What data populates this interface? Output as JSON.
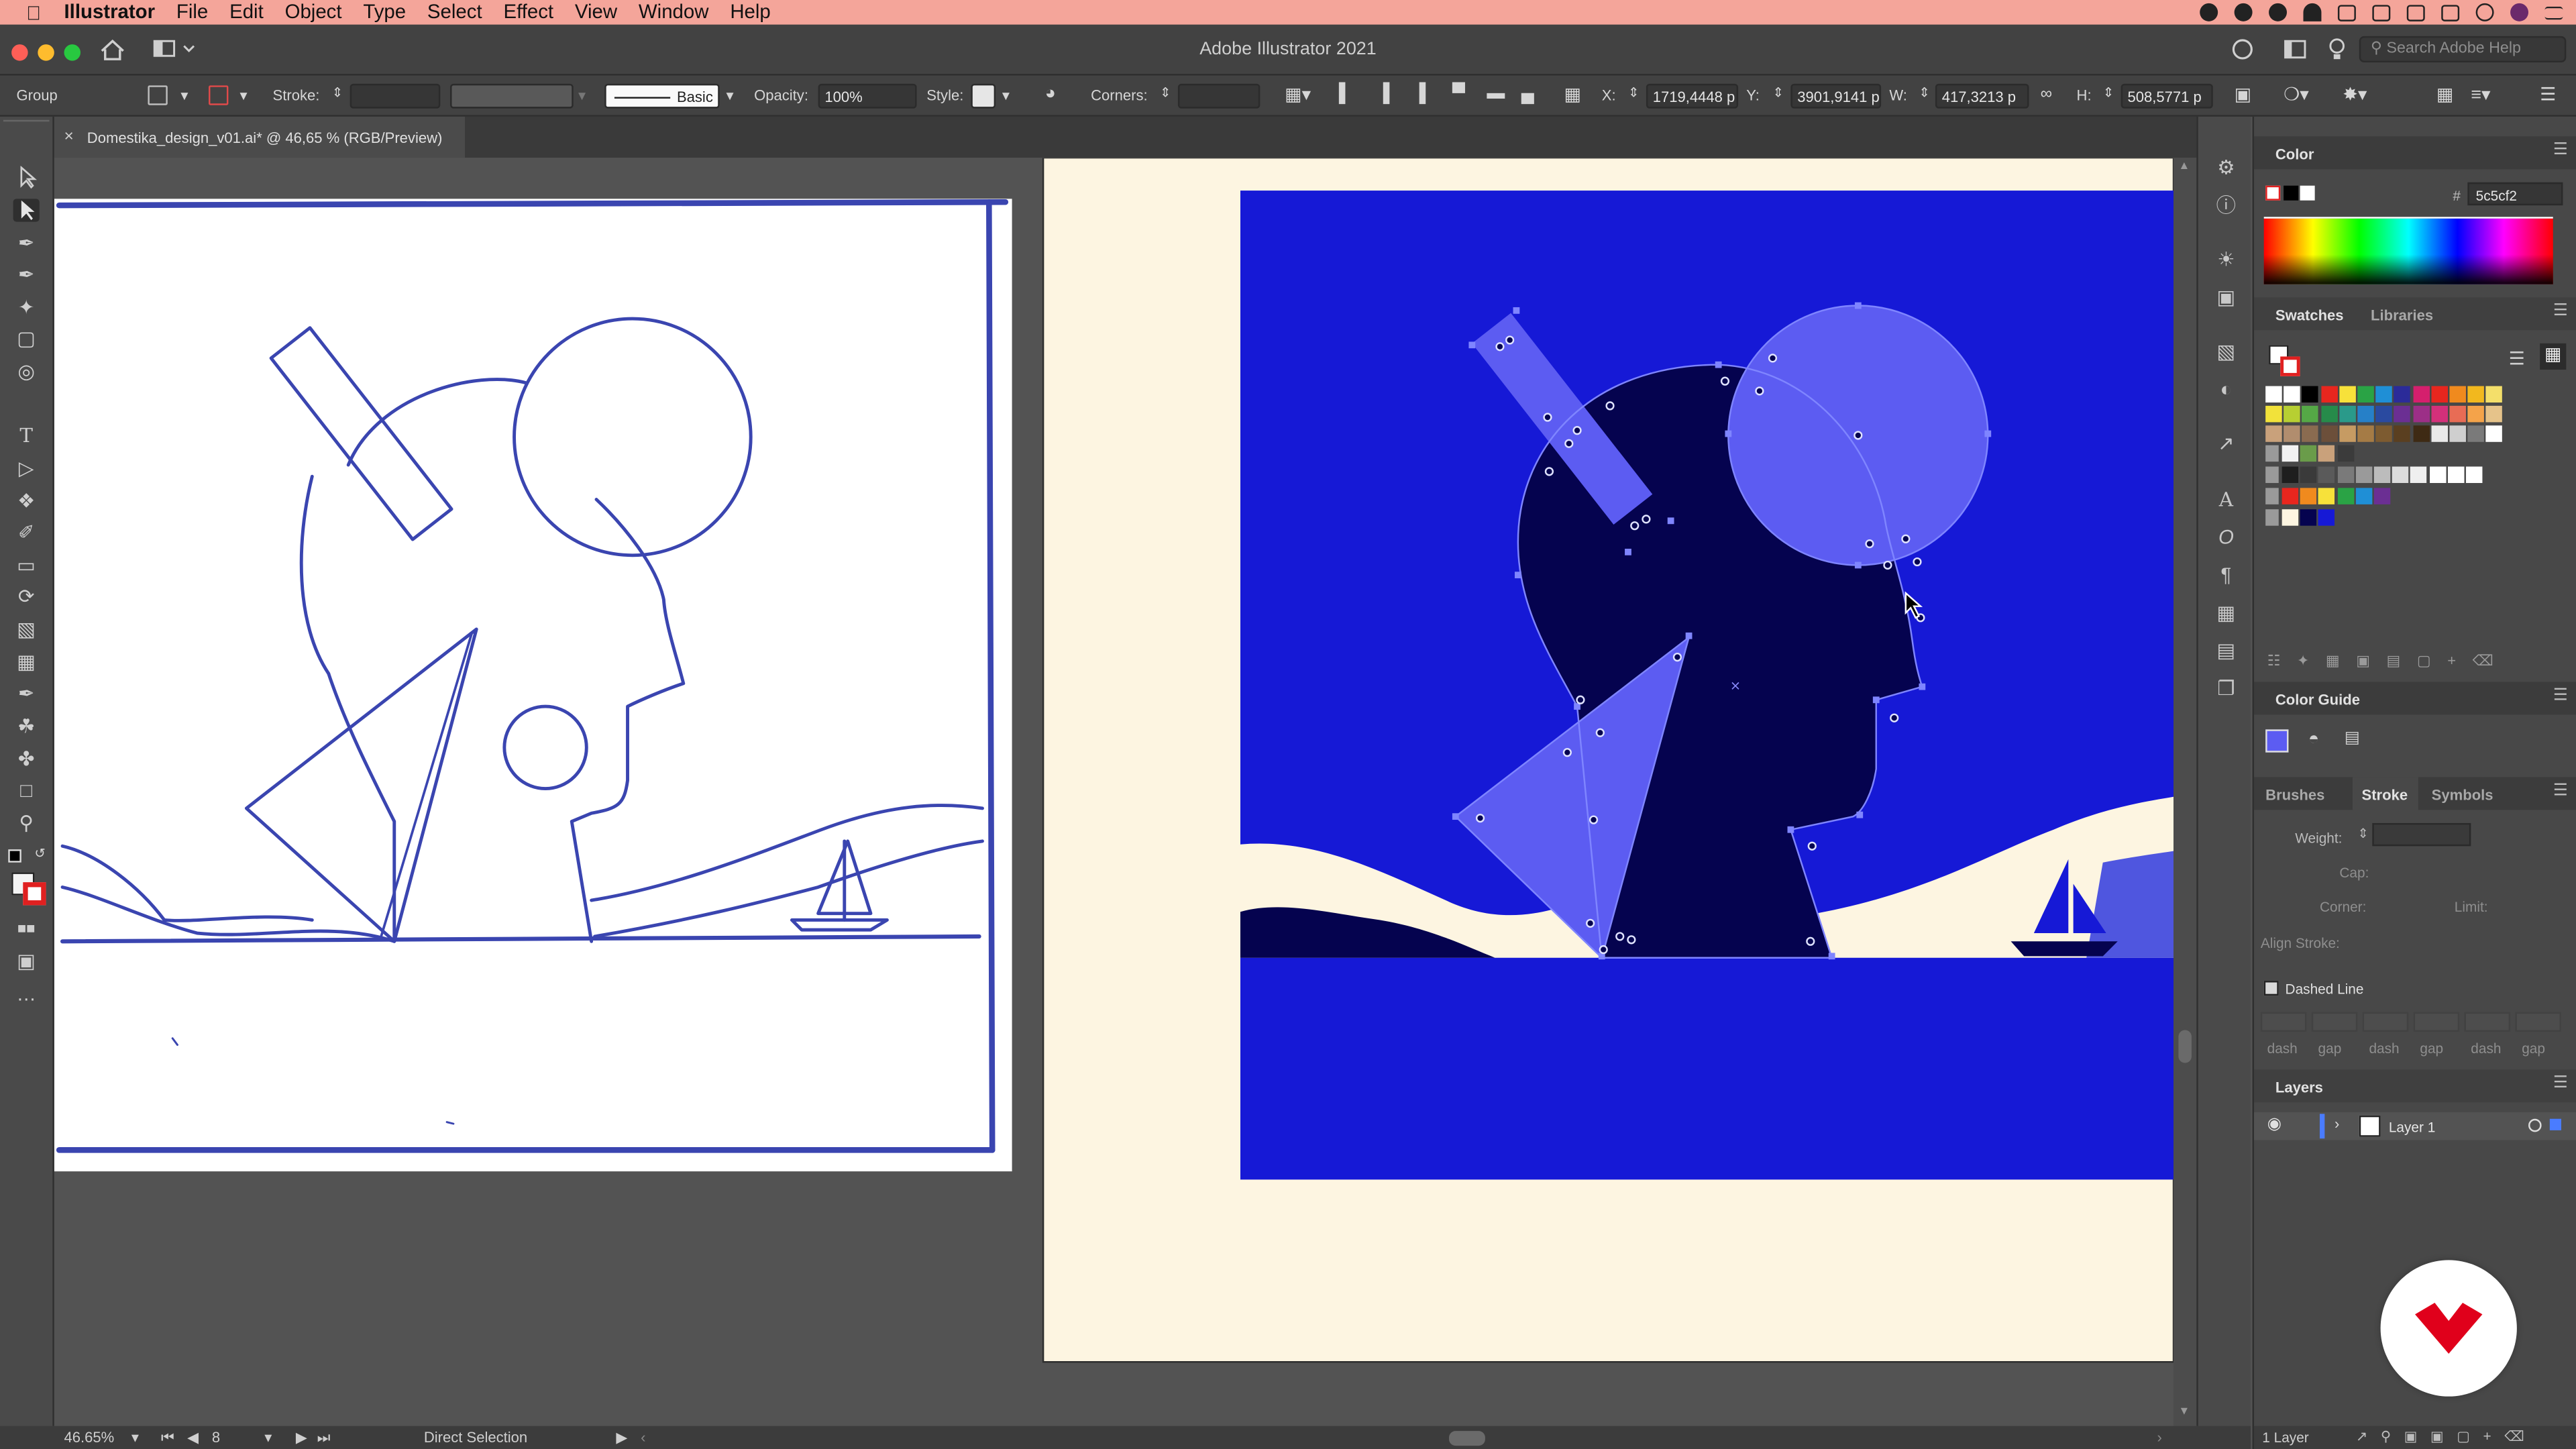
{
  "menubar": {
    "app_name": "Illustrator",
    "items": [
      "File",
      "Edit",
      "Object",
      "Type",
      "Select",
      "Effect",
      "View",
      "Window",
      "Help"
    ]
  },
  "window": {
    "title": "Adobe Illustrator 2021",
    "search_placeholder": "Search Adobe Help"
  },
  "control_bar": {
    "selection_type": "Group",
    "stroke_label": "Stroke:",
    "brush_style": "Basic",
    "opacity_label": "Opacity:",
    "opacity_value": "100%",
    "style_label": "Style:",
    "corners_label": "Corners:",
    "x_label": "X:",
    "x_value": "1719,4448 p",
    "y_label": "Y:",
    "y_value": "3901,9141 p",
    "w_label": "W:",
    "w_value": "417,3213 p",
    "h_label": "H:",
    "h_value": "508,5771 p"
  },
  "document": {
    "tab_title": "Domestika_design_v01.ai* @ 46,65 % (RGB/Preview)",
    "close_glyph": "×"
  },
  "tools": [
    "selection-tool",
    "direct-selection-tool",
    "pen-tool",
    "curvature-tool",
    "magic-wand-tool",
    "rectangle-tool",
    "spiral-tool",
    "type-tool",
    "reflect-tool",
    "width-tool",
    "shaper-tool",
    "eraser-tool",
    "scale-tool",
    "gradient-tool",
    "eyedropper-tool",
    "live-paint-tool",
    "artboard-tool",
    "zoom-tool"
  ],
  "panels": {
    "color": {
      "title": "Color",
      "hex_label": "#",
      "hex_value": "5c5cf2"
    },
    "swatches": {
      "tab_active": "Swatches",
      "tab_other": "Libraries"
    },
    "color_guide": {
      "title": "Color Guide"
    },
    "brushes_tab": "Brushes",
    "stroke_tab": "Stroke",
    "symbols_tab": "Symbols",
    "stroke": {
      "weight_label": "Weight:",
      "cap_label": "Cap:",
      "corner_label": "Corner:",
      "limit_label": "Limit:",
      "align_label": "Align Stroke:",
      "dashed_label": "Dashed Line",
      "dash_labels": [
        "dash",
        "gap",
        "dash",
        "gap",
        "dash",
        "gap"
      ]
    },
    "layers": {
      "title": "Layers",
      "layer_name": "Layer 1",
      "footer_count": "1 Layer"
    }
  },
  "status": {
    "zoom": "46.65%",
    "artboard_number": "8",
    "tool_name": "Direct Selection"
  },
  "colors": {
    "menubar": "#f4a59a",
    "artboard_bg": "#fdf5e1",
    "deep_blue": "#1619d6",
    "navy": "#05034f",
    "selection_blue": "#5c5cf2",
    "sketch_line": "#3a45b0"
  }
}
